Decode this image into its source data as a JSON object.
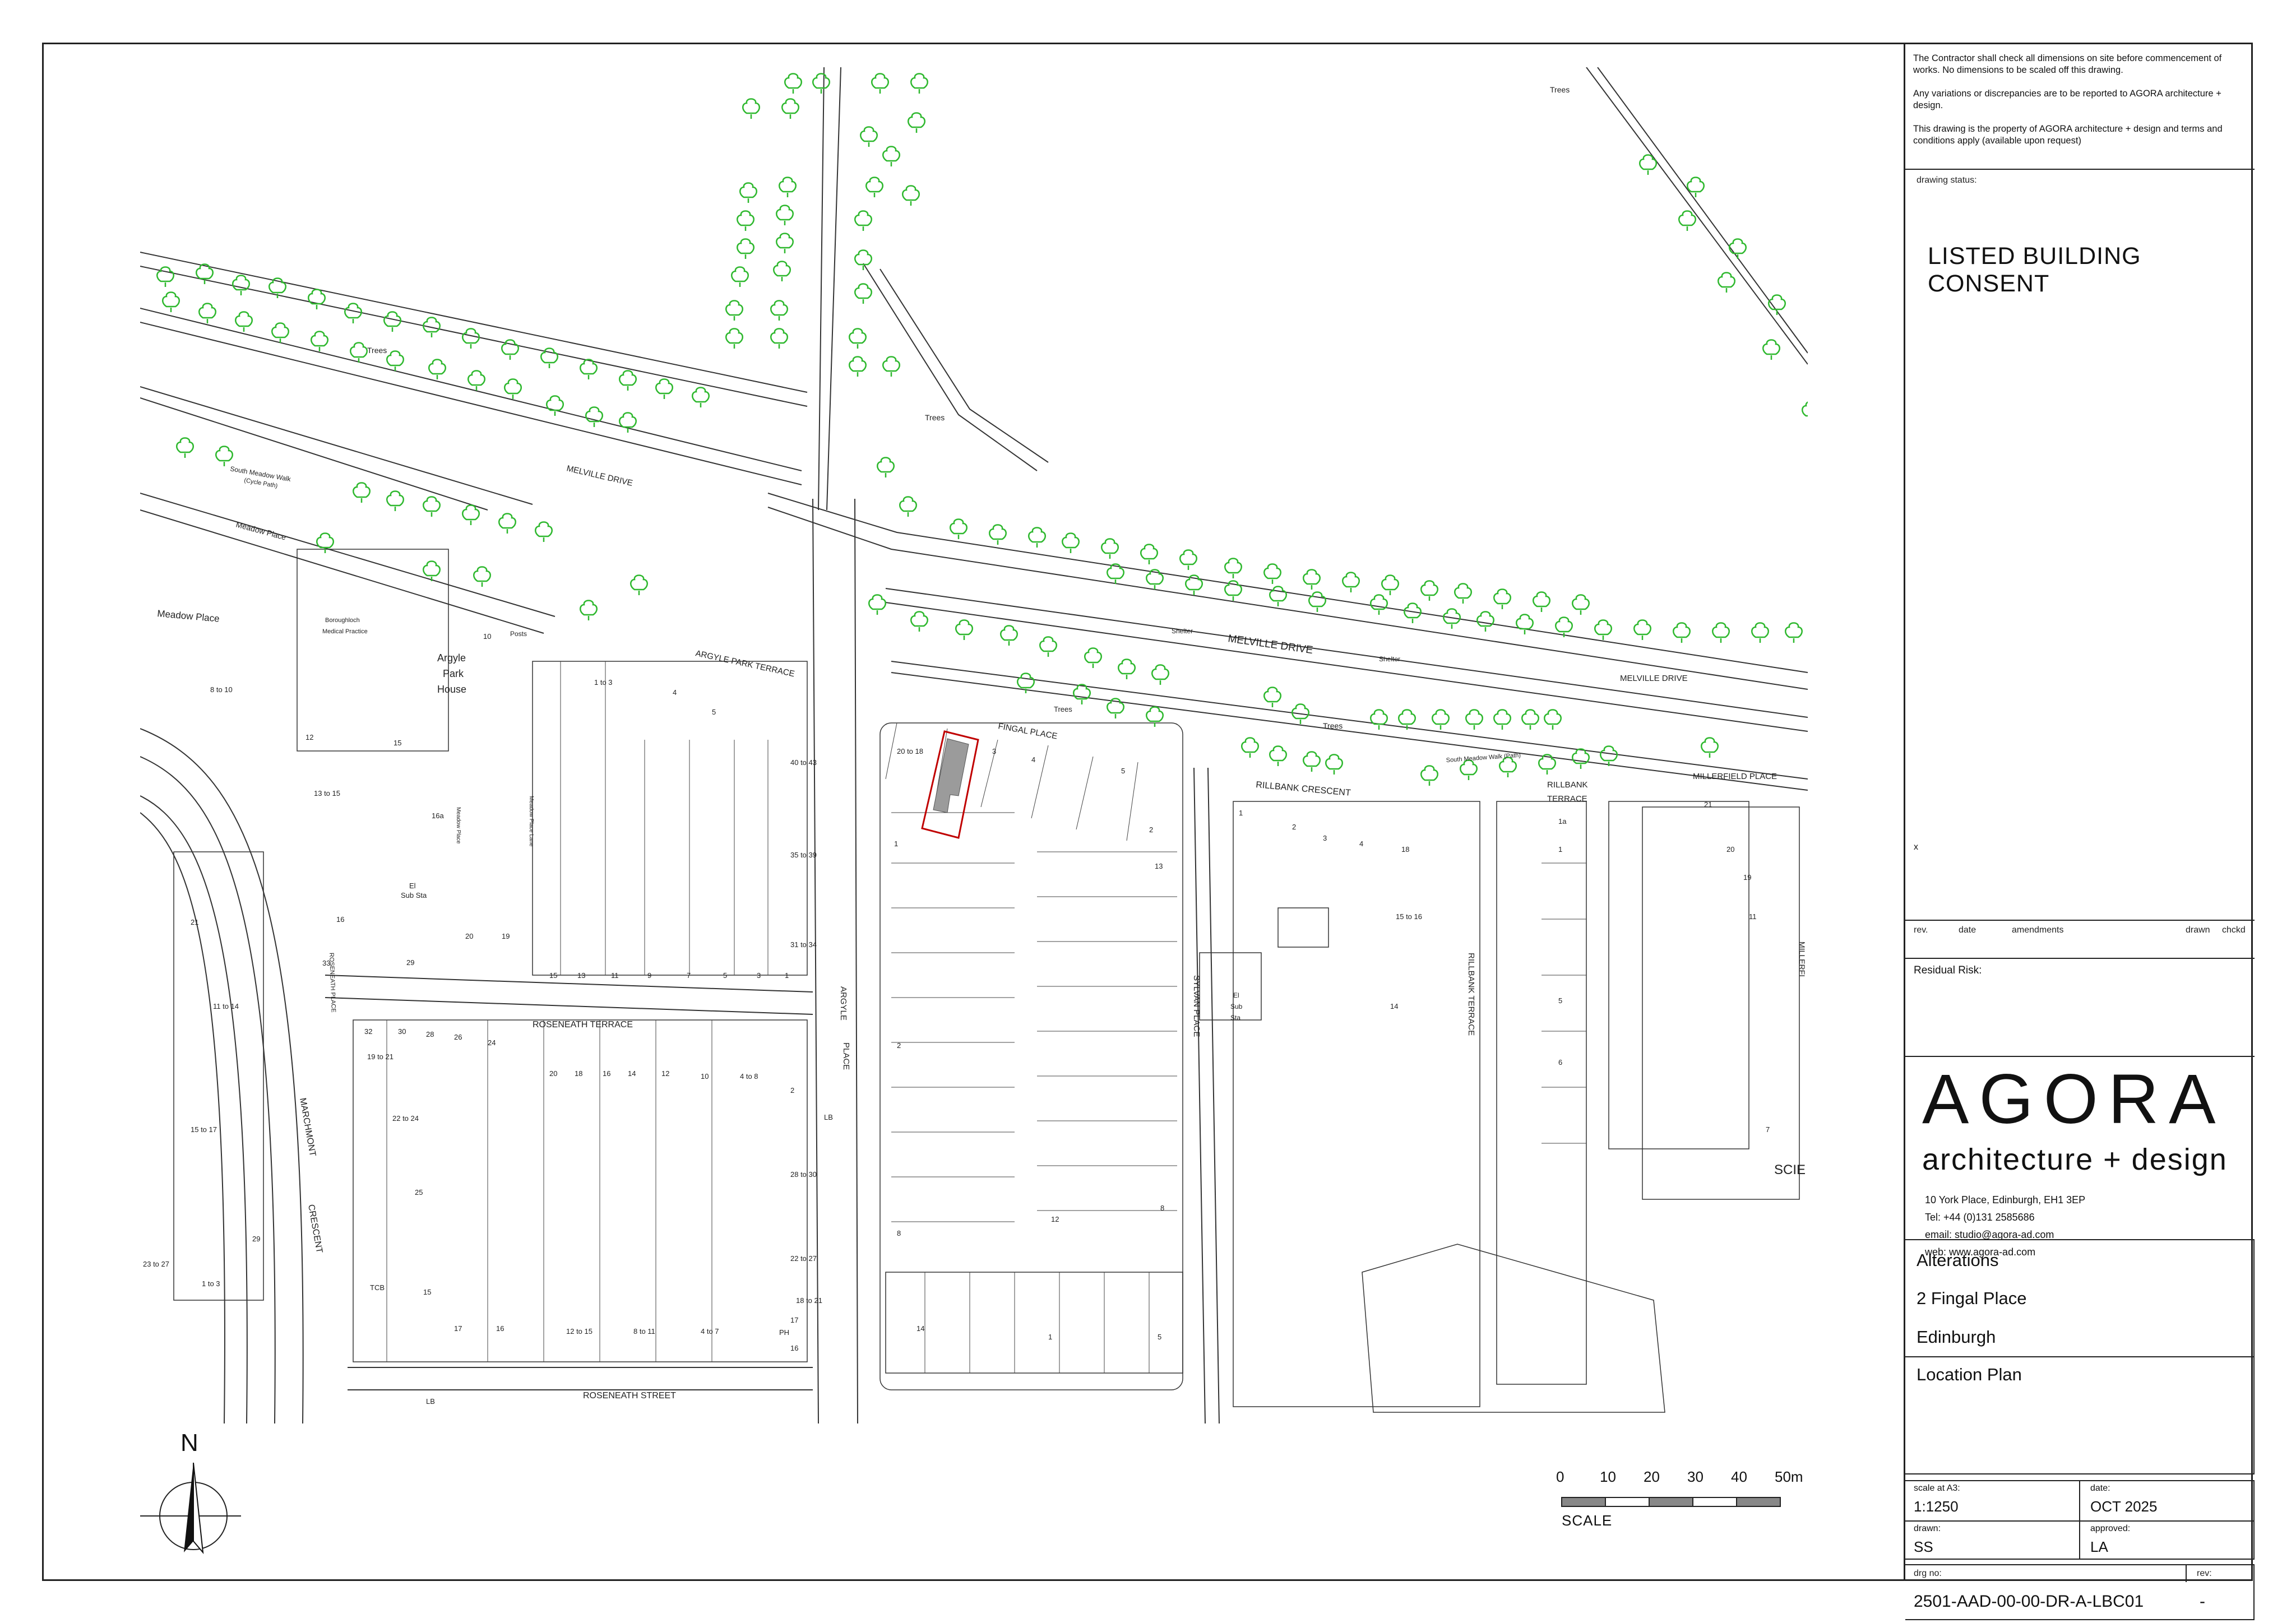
{
  "notes": [
    "The Contractor shall check all dimensions on site before commencement of works. No dimensions to be scaled off this drawing.",
    "Any variations or discrepancies are to be reported to AGORA architecture + design.",
    "This drawing is the property of AGORA architecture + design and terms and conditions apply (available upon request)"
  ],
  "status": {
    "caption": "drawing status:",
    "title": "LISTED BUILDING CONSENT",
    "mark": "x"
  },
  "revisions": {
    "rev": "rev.",
    "date": "date",
    "amendments": "amendments",
    "drawn": "drawn",
    "checked": "chckd"
  },
  "residual_risk": "Residual Risk:",
  "brand": {
    "logo": "AGORA",
    "tagline": "architecture + design",
    "address": "10 York Place, Edinburgh, EH1 3EP",
    "tel": "Tel: +44  (0)131 2585686",
    "email": "email: studio@agora-ad.com",
    "web": "web: www.agora-ad.com"
  },
  "project": {
    "line1": "Alterations",
    "line2": "2 Fingal Place",
    "line3": "Edinburgh",
    "drawing_title": "Location Plan"
  },
  "meta": {
    "scale_caption": "scale at A3:",
    "scale": "1:1250",
    "date_caption": "date:",
    "date": "OCT 2025",
    "drawn_caption": "drawn:",
    "drawn": "SS",
    "approved_caption": "approved:",
    "approved": "LA",
    "drg_caption": "drg no:",
    "drg": "2501-AAD-00-00-DR-A-LBC01",
    "rev_caption": "rev:",
    "rev": "-"
  },
  "scale_bar": {
    "ticks": [
      "0",
      "10",
      "20",
      "30",
      "40",
      "50m"
    ],
    "label": "SCALE"
  },
  "north": "N",
  "map_labels": {
    "melville_drive_1": "MELVILLE DRIVE",
    "melville_drive_2": "MELVILLE DRIVE",
    "melville_drive_3": "MELVILLE   DRIVE",
    "south_meadow_walk": "South Meadow Walk",
    "cycle_path": "(Cycle Path)",
    "south_meadow_walk_path": "South Meadow Walk (Path)",
    "meadow_place_1": "Meadow Place",
    "meadow_place_2": "Meadow Place",
    "argyle_park_terrace": "ARGYLE PARK TERRACE",
    "argyle_park_house_1": "Argyle",
    "argyle_park_house_2": "Park",
    "argyle_park_house_3": "House",
    "posts": "Posts",
    "borough": "Boroughloch",
    "medical": "Medical Practice",
    "fingal_place": "FINGAL PLACE",
    "trees_1": "Trees",
    "trees_2": "Trees",
    "trees_3": "Trees",
    "trees_4": "Trees",
    "trees_5": "Trees",
    "shelter_1": "Shelter",
    "shelter_2": "Shelter",
    "rillbank_crescent": "RILLBANK  CRESCENT",
    "rillbank_terrace_1": "RILLBANK",
    "rillbank_terrace_2": "TERRACE",
    "rillbank_terrace_v": "RILLBANK TERRACE",
    "millerfield_place": "MILLERFIELD PLACE",
    "millerfield_v": "MILLERFI",
    "sylvan_place": "SYLVAN PLACE",
    "argyle": "ARGYLE",
    "place": "PLACE",
    "roseneath_terrace": "ROSENEATH TERRACE",
    "roseneath_place": "ROSENEATH PLACE",
    "roseneath_street": "ROSENEATH STREET",
    "marchmont": "MARCHMONT",
    "crescent": "CRESCENT",
    "sub_sta_1": "El",
    "sub_sta_2": "Sub Sta",
    "sub_sta_3": "El",
    "sub_sta_4": "Sub",
    "sub_sta_5": "Sta",
    "lb_1": "LB",
    "lb_2": "LB",
    "tcb": "TCB",
    "ph": "PH",
    "scie": "SCIE",
    "meadow_place_lane": "Meadow Place Lane",
    "meadow_place_v": "Meadow Place"
  },
  "house_numbers": [
    "10",
    "8 to 10",
    "12",
    "13 to 15",
    "16",
    "15",
    "16a",
    "33",
    "29",
    "20",
    "19",
    "15",
    "13",
    "11",
    "9",
    "7",
    "5",
    "3",
    "1",
    "40 to 43",
    "35 to 39",
    "31 to 34",
    "1 to 3",
    "4",
    "5",
    "32",
    "30",
    "28",
    "26",
    "24",
    "19 to 21",
    "22 to 24",
    "25",
    "20",
    "18",
    "16",
    "14",
    "12",
    "10",
    "4 to 8",
    "2",
    "28 to 30",
    "22 to 27",
    "18 to 21",
    "17",
    "16",
    "15",
    "17",
    "16",
    "12 to 15",
    "8 to 11",
    "4 to 7",
    "1 to 3",
    "23 to 27",
    "29",
    "21",
    "11 to 14",
    "15 to 17",
    "20 to 18",
    "1",
    "2",
    "8",
    "14",
    "1",
    "5",
    "8",
    "12",
    "13",
    "2",
    "3",
    "4",
    "5",
    "1",
    "2",
    "3",
    "4",
    "18",
    "15 to 16",
    "14",
    "1a",
    "1",
    "5",
    "6",
    "21",
    "20",
    "19",
    "11",
    "7"
  ]
}
